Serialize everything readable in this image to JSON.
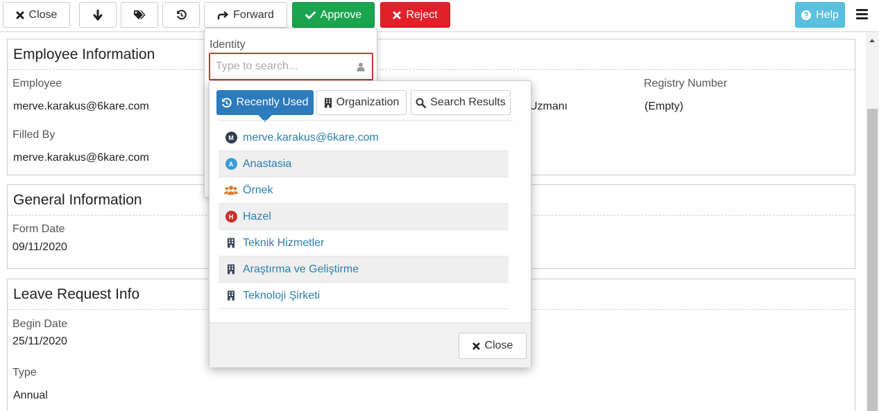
{
  "toolbar": {
    "close_label": "Close",
    "forward_label": "Forward",
    "approve_label": "Approve",
    "reject_label": "Reject",
    "help_label": "Help"
  },
  "panels": {
    "employee": {
      "title": "Employee Information",
      "employee_label": "Employee",
      "employee_value": "merve.karakus@6kare.com",
      "filled_by_label": "Filled By",
      "filled_by_value": "merve.karakus@6kare.com",
      "partial_value": "Uzmanı",
      "registry_label": "Registry Number",
      "registry_value": "(Empty)"
    },
    "general": {
      "title": "General Information",
      "form_date_label": "Form Date",
      "form_date_value": "09/11/2020"
    },
    "leave": {
      "title": "Leave Request Info",
      "begin_date_label": "Begin Date",
      "begin_date_value": "25/11/2020",
      "type_label": "Type",
      "type_value": "Annual"
    }
  },
  "forward_popup": {
    "identity_label": "Identity",
    "search_placeholder": "Type to search..."
  },
  "picker": {
    "tabs": {
      "recent": "Recently Used",
      "organization": "Organization",
      "search": "Search Results"
    },
    "items": [
      {
        "label": "merve.karakus@6kare.com",
        "icon": "user-avatar-M",
        "avatar_letter": "M",
        "avatar_color": "#2f3e4e"
      },
      {
        "label": "Anastasia",
        "icon": "user-avatar-A",
        "avatar_letter": "A",
        "avatar_color": "#3a9bd9"
      },
      {
        "label": "Örnek",
        "icon": "group-icon",
        "avatar_color": "#e07b2a"
      },
      {
        "label": "Hazel",
        "icon": "user-avatar-H",
        "avatar_letter": "H",
        "avatar_color": "#c9302c"
      },
      {
        "label": "Teknik Hizmetler",
        "icon": "building-icon"
      },
      {
        "label": "Araştırma ve Geliştirme",
        "icon": "building-icon"
      },
      {
        "label": "Teknoloji Şirketi",
        "icon": "building-icon"
      }
    ],
    "close_label": "Close"
  },
  "colors": {
    "approve": "#1aa54e",
    "reject": "#e2202a",
    "help": "#5bc0de",
    "active_tab": "#2b7bbd",
    "link": "#2a7fb0"
  }
}
